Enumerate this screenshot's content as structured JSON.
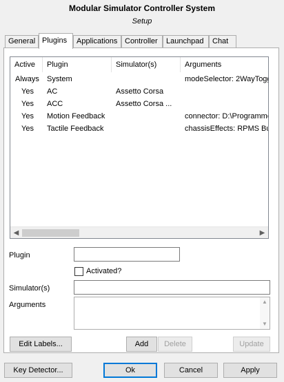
{
  "window": {
    "title": "Modular Simulator Controller System",
    "subtitle": "Setup"
  },
  "tabs": [
    {
      "label": "General",
      "active": false
    },
    {
      "label": "Plugins",
      "active": true
    },
    {
      "label": "Applications",
      "active": false
    },
    {
      "label": "Controller",
      "active": false
    },
    {
      "label": "Launchpad",
      "active": false
    },
    {
      "label": "Chat",
      "active": false
    }
  ],
  "plugins_table": {
    "columns": [
      "Active",
      "Plugin",
      "Simulator(s)",
      "Arguments"
    ],
    "rows": [
      [
        "Always",
        "System",
        "",
        "modeSelector: 2WayTogg"
      ],
      [
        "Yes",
        "AC",
        "Assetto Corsa",
        ""
      ],
      [
        "Yes",
        "ACC",
        "Assetto Corsa ...",
        ""
      ],
      [
        "Yes",
        "Motion Feedback",
        "",
        "connector: D:\\Programme"
      ],
      [
        "Yes",
        "Tactile Feedback",
        "",
        "chassisEffects: RPMS Bu"
      ]
    ]
  },
  "form": {
    "plugin_label": "Plugin",
    "plugin_value": "",
    "activated_label": "Activated?",
    "activated_checked": false,
    "simulators_label": "Simulator(s)",
    "simulators_value": "",
    "arguments_label": "Arguments",
    "arguments_value": ""
  },
  "panel_buttons": {
    "edit_labels": "Edit Labels...",
    "add": "Add",
    "delete": "Delete",
    "update": "Update"
  },
  "footer_buttons": {
    "key_detector": "Key Detector...",
    "ok": "Ok",
    "cancel": "Cancel",
    "apply": "Apply"
  },
  "icons": {
    "scroll_left": "arrow-left-icon",
    "scroll_right": "arrow-right-icon",
    "scroll_up": "arrow-up-icon",
    "scroll_down": "arrow-down-icon"
  }
}
